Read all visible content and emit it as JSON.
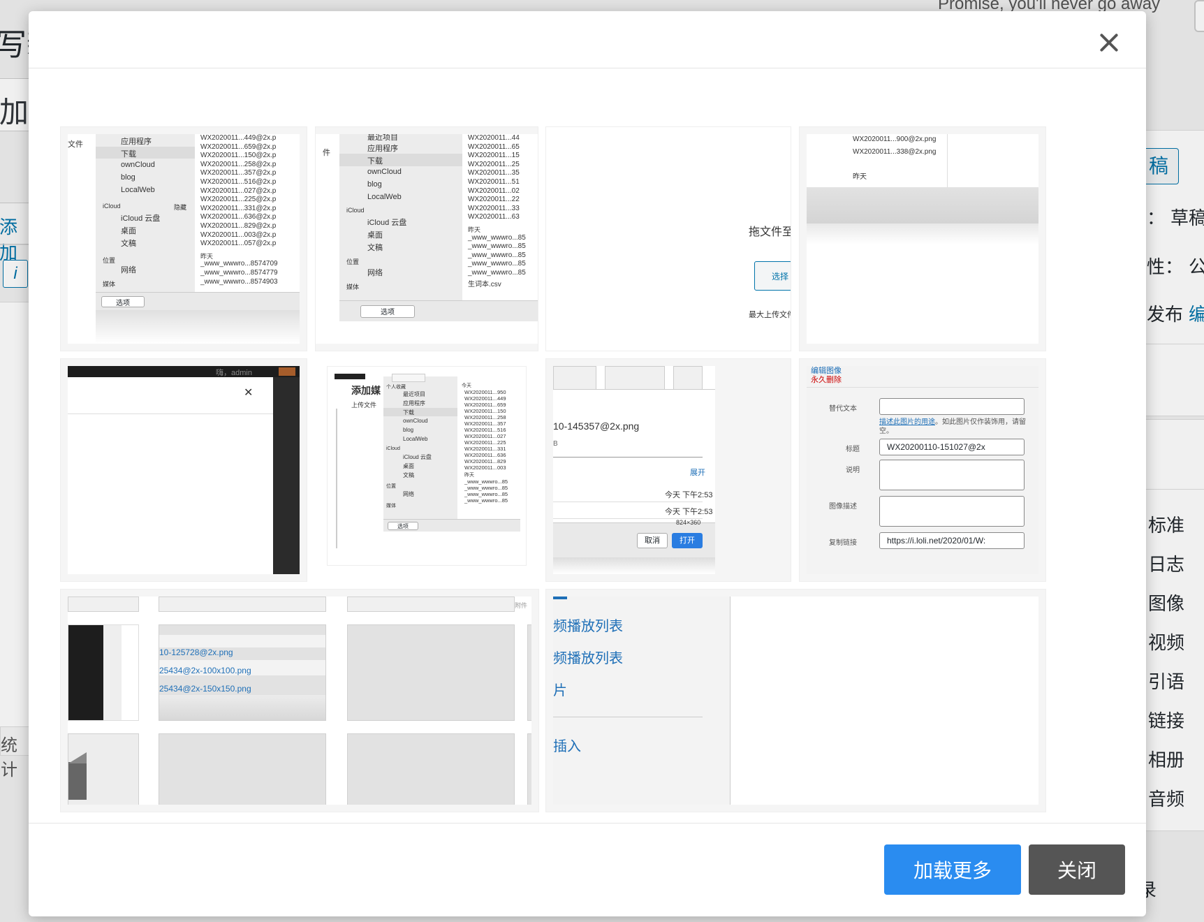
{
  "background": {
    "song_text": "Promise, you'll never go away",
    "page_title_fragment": "写新",
    "title_input_fragment": "加",
    "add_media_fragment": "添加",
    "info_button": "i",
    "stats_fragment": "统计",
    "sidebar": {
      "draft_button": "稿",
      "status_label": "：",
      "status_value": "草稿",
      "visibility_label": "性：",
      "visibility_value": "公",
      "publish_label": "发布",
      "publish_edit": "编",
      "formats": [
        "标准",
        "日志",
        "图像",
        "视频",
        "引语",
        "链接",
        "相册",
        "音频"
      ],
      "bottom_fragment": "录"
    }
  },
  "modal": {
    "close_icon": "close-icon",
    "load_more_label": "加载更多",
    "close_label": "关闭"
  },
  "thumbs": {
    "t1": {
      "header": "文件",
      "sidebar": [
        "应用程序",
        "下载",
        "ownCloud",
        "blog",
        "LocalWeb"
      ],
      "icloud_label": "iCloud",
      "hide_label": "隐藏",
      "icloud_items": [
        "iCloud 云盘",
        "桌面",
        "文稿"
      ],
      "location_label": "位置",
      "network": "网络",
      "media_label": "媒体",
      "files": [
        "WX2020011...449@2x.p",
        "WX2020011...659@2x.p",
        "WX2020011...150@2x.p",
        "WX2020011...258@2x.p",
        "WX2020011...357@2x.p",
        "WX2020011...516@2x.p",
        "WX2020011...027@2x.p",
        "WX2020011...225@2x.p",
        "WX2020011...331@2x.p",
        "WX2020011...636@2x.p",
        "WX2020011...829@2x.p",
        "WX2020011...003@2x.p",
        "WX2020011...057@2x.p"
      ],
      "yesterday": "昨天",
      "y_files": [
        "_www_wwwro...8574709",
        "_www_wwwro...8574779",
        "_www_wwwro...8574903"
      ],
      "options": "选项"
    },
    "t2": {
      "header": "件",
      "sidebar": [
        "最近项目",
        "应用程序",
        "下载",
        "ownCloud",
        "blog",
        "LocalWeb"
      ],
      "icloud_label": "iCloud",
      "icloud_items": [
        "iCloud 云盘",
        "桌面",
        "文稿"
      ],
      "location_label": "位置",
      "network": "网络",
      "media_label": "媒体",
      "files": [
        "WX2020011...44",
        "WX2020011...65",
        "WX2020011...15",
        "WX2020011...25",
        "WX2020011...35",
        "WX2020011...51",
        "WX2020011...02",
        "WX2020011...22",
        "WX2020011...33",
        "WX2020011...63"
      ],
      "yesterday": "昨天",
      "y_files": [
        "_www_wwwro...85",
        "_www_wwwro...85",
        "_www_wwwro...85",
        "_www_wwwro...85",
        "_www_wwwro...85",
        "生词本.csv"
      ],
      "options": "选项"
    },
    "t3": {
      "drag_text": "拖文件至",
      "select_btn": "选择",
      "max_upload": "最大上传文件"
    },
    "t4": {
      "files": [
        "WX2020011...900@2x.png",
        "WX2020011...338@2x.png"
      ],
      "yesterday": "昨天"
    },
    "t5": {
      "user_text": "嗨，admin"
    },
    "t6": {
      "title": "添加媒",
      "upload_tab": "上传文件",
      "fav_label": "个人收藏",
      "sidebar": [
        "最近项目",
        "应用程序",
        "下载",
        "ownCloud",
        "blog",
        "LocalWeb"
      ],
      "icloud_label": "iCloud",
      "icloud_items": [
        "iCloud 云盘",
        "桌面",
        "文稿"
      ],
      "location_label": "位置",
      "network": "网络",
      "media_label": "媒体",
      "today": "今天",
      "files": [
        "WX2020011...950",
        "WX2020011...449",
        "WX2020011...659",
        "WX2020011...150",
        "WX2020011...258",
        "WX2020011...357",
        "WX2020011...516",
        "WX2020011...027",
        "WX2020011...225",
        "WX2020011...331",
        "WX2020011...636",
        "WX2020011...829",
        "WX2020011...003"
      ],
      "yesterday": "昨天",
      "y_files": [
        "_www_wwwro...85",
        "_www_wwwro...85",
        "_www_wwwro...85",
        "_www_wwwro...85"
      ],
      "options": "选项"
    },
    "t7": {
      "filename": "10-145357@2x.png",
      "size_frag": "B",
      "expand": "展开",
      "date1": "今天 下午2:53",
      "date2": "今天 下午2:53",
      "dims": "824×360",
      "cancel": "取消",
      "open": "打开"
    },
    "t8": {
      "edit_image": "编辑图像",
      "delete": "永久删除",
      "alt_label": "替代文本",
      "alt_help_link": "描述此图片的用途",
      "alt_help_rest": "。如此图片仅作装饰用，请留空。",
      "title_label": "标题",
      "title_value": "WX20200110-151027@2x",
      "caption_label": "说明",
      "desc_label": "图像描述",
      "copy_label": "复制链接",
      "copy_value": "https://i.loli.net/2020/01/W:"
    },
    "t9": {
      "files": [
        "10-125728@2x.png",
        "25434@2x-100x100.png",
        "25434@2x-150x150.png"
      ],
      "corner": "附件"
    },
    "t10": {
      "links": [
        "频播放列表",
        "频播放列表",
        "片"
      ],
      "insert": "插入"
    }
  }
}
